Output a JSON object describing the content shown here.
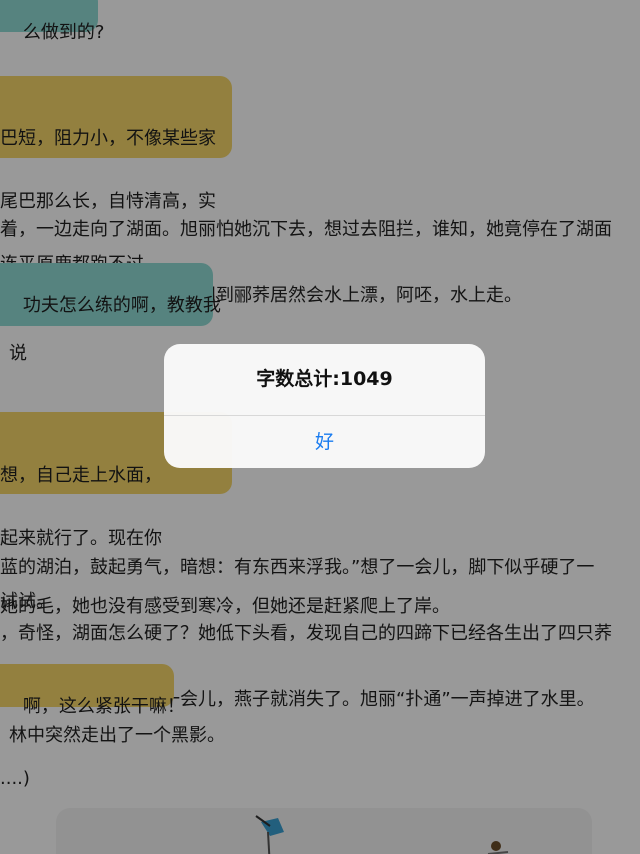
{
  "background": {
    "bubble_1": "么做到的?",
    "bubble_2": [
      "巴短，阻力小，不像某些家",
      "尾巴那么长，自恃清高，实",
      "连平原鹿都跑不过。"
    ],
    "para_1": [
      "着，一边走向了湖面。旭丽怕她沉下去，想过去阻拦，谁知，她竟停在了湖面",
      "起来。旭丽看呆了，她没想到郦荞居然会水上漂，阿呸，水上走。"
    ],
    "bubble_3": "功夫怎么练的啊，教教我",
    "say_fragment": "说",
    "bubble_4": [
      "想，自己走上水面，",
      "起来就行了。现在你",
      "试试。"
    ],
    "para_2": [
      "蓝的湖泊，鼓起勇气，暗想：有东西来浮我。”想了一会儿，脚下似乎硬了一",
      "，奇怪，湖面怎么硬了？她低下头看，发现自己的四蹄下已经各生出了四只荞",
      "份鲜艳。旭丽呆站了一会儿，燕子就消失了。旭丽“扑通”一声掉进了水里。"
    ],
    "para_3": "她的毛，她也没有感受到寒冷，但她还是赶紧爬上了岸。",
    "bubble_5": "啊，这么紧张干嘛！",
    "para_4": "林中突然走出了一个黑影。",
    "para_5": "....)"
  },
  "alert": {
    "title": "字数总计:1049",
    "button_label": "好"
  },
  "colors": {
    "teal_bubble": "#8fdad4",
    "yellow_bubble": "#f5d66a",
    "alert_button": "#1a7cf0",
    "dim_overlay": "rgba(0,0,0,0.40)"
  }
}
